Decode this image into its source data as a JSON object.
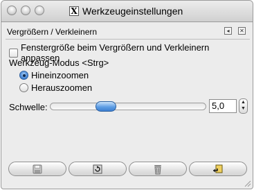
{
  "window": {
    "title": "Werkzeugeinstellungen",
    "title_icon": "X"
  },
  "dock": {
    "title": "Vergrößern / Verkleinern"
  },
  "options": {
    "resize_window_label": "Fenstergröße beim Vergrößern und Verkleinern anpassen",
    "resize_window_checked": false,
    "tool_mode_label": "Werkzeug-Modus  <Strg>",
    "zoom_in_label": "Hineinzoomen",
    "zoom_out_label": "Herauszoomen",
    "selected_mode": "zoom_in",
    "threshold_label": "Schwelle:",
    "threshold_value": "5,0",
    "threshold_fraction": 0.33
  },
  "buttons": [
    {
      "icon": "save-icon"
    },
    {
      "icon": "restore-icon"
    },
    {
      "icon": "trash-icon"
    },
    {
      "icon": "reset-icon"
    }
  ],
  "colors": {
    "accent": "#3d7fd1",
    "window_bg": "#ececec"
  }
}
